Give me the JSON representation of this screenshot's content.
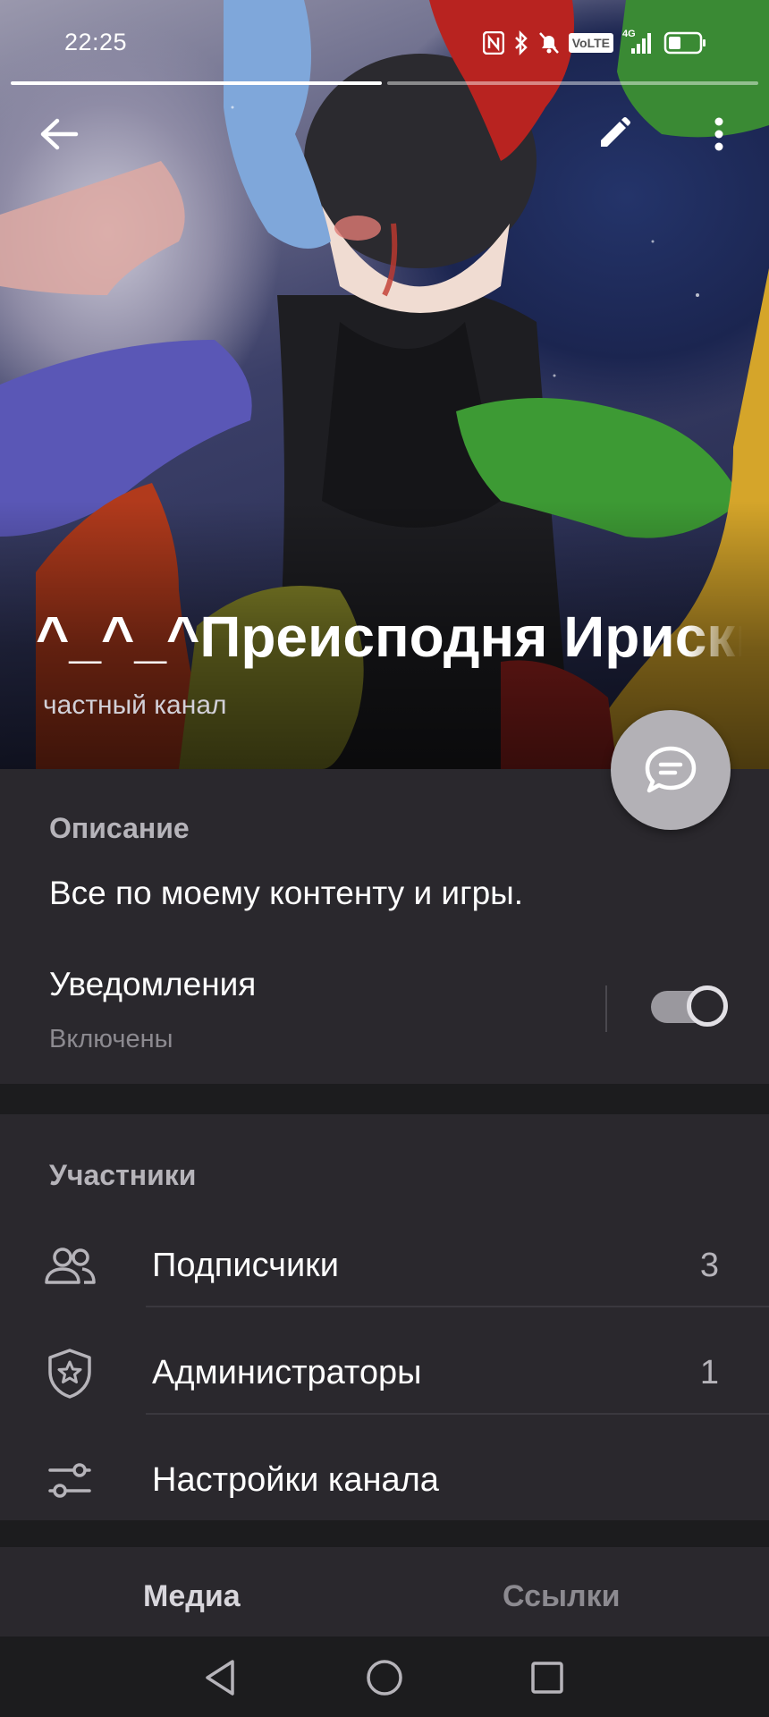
{
  "status_bar": {
    "time": "22:25",
    "icons": [
      "nfc-icon",
      "bluetooth-icon",
      "mute-bell-icon",
      "volte-badge",
      "signal-4g-icon",
      "battery-icon"
    ],
    "volte_label": "VoLTE",
    "network_label": "4G"
  },
  "story_progress": {
    "segments": 2,
    "active": 1
  },
  "header": {
    "back_icon": "arrow-left-icon",
    "edit_icon": "pencil-icon",
    "more_icon": "more-vertical-icon"
  },
  "channel": {
    "title": "^_^_^Преисподня Ириски",
    "subtitle": "частный канал"
  },
  "fab": {
    "icon": "chat-bubble-icon"
  },
  "description": {
    "heading": "Описание",
    "text": "Все по моему контенту и игры."
  },
  "notifications": {
    "title": "Уведомления",
    "status": "Включены",
    "enabled": true
  },
  "members": {
    "heading": "Участники",
    "items": [
      {
        "label": "Подписчики",
        "count": "3",
        "icon": "people-icon"
      },
      {
        "label": "Администраторы",
        "count": "1",
        "icon": "shield-star-icon"
      },
      {
        "label": "Настройки канала",
        "count": "",
        "icon": "sliders-icon"
      }
    ]
  },
  "tabs": [
    {
      "label": "Медиа",
      "active": true
    },
    {
      "label": "Ссылки",
      "active": false
    }
  ],
  "nav": {
    "icons": [
      "nav-back-icon",
      "nav-home-icon",
      "nav-recents-icon"
    ]
  },
  "colors": {
    "background": "#1c1c1e",
    "card": "#2a282d",
    "section_title": "#b6b4ba",
    "muted": "#8c8a90",
    "fab": "#b3b1b6"
  }
}
